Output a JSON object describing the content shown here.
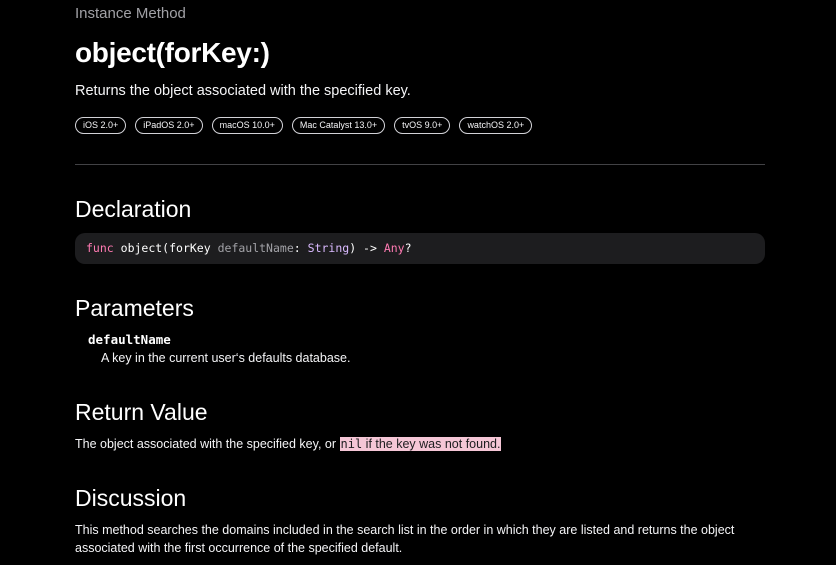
{
  "header": {
    "eyebrow": "Instance Method",
    "title": "object(forKey:)",
    "abstract": "Returns the object associated with the specified key."
  },
  "availability": [
    "iOS 2.0+",
    "iPadOS 2.0+",
    "macOS 10.0+",
    "Mac Catalyst 13.0+",
    "tvOS 9.0+",
    "watchOS 2.0+"
  ],
  "declaration": {
    "heading": "Declaration",
    "tokens": {
      "keyword": "func",
      "name": "object(forKey",
      "param": "defaultName",
      "colon": ":",
      "type": "String",
      "arrow": ") ->",
      "return_type": "Any",
      "optional": "?"
    }
  },
  "parameters": {
    "heading": "Parameters",
    "items": [
      {
        "name": "defaultName",
        "description": "A key in the current user‘s defaults database."
      }
    ]
  },
  "return_value": {
    "heading": "Return Value",
    "text_before": "The object associated with the specified key, or ",
    "highlight_code": "nil",
    "highlight_text": " if the key was not found."
  },
  "discussion": {
    "heading": "Discussion",
    "text": "This method searches the domains included in the search list in the order in which they are listed and returns the object associated with the first occurrence of the specified default."
  },
  "colors": {
    "background": "#000000",
    "keyword": "#ff7ab2",
    "type": "#dabaff",
    "highlight": "#f5c6d6",
    "code_background": "#1d1d1f"
  }
}
